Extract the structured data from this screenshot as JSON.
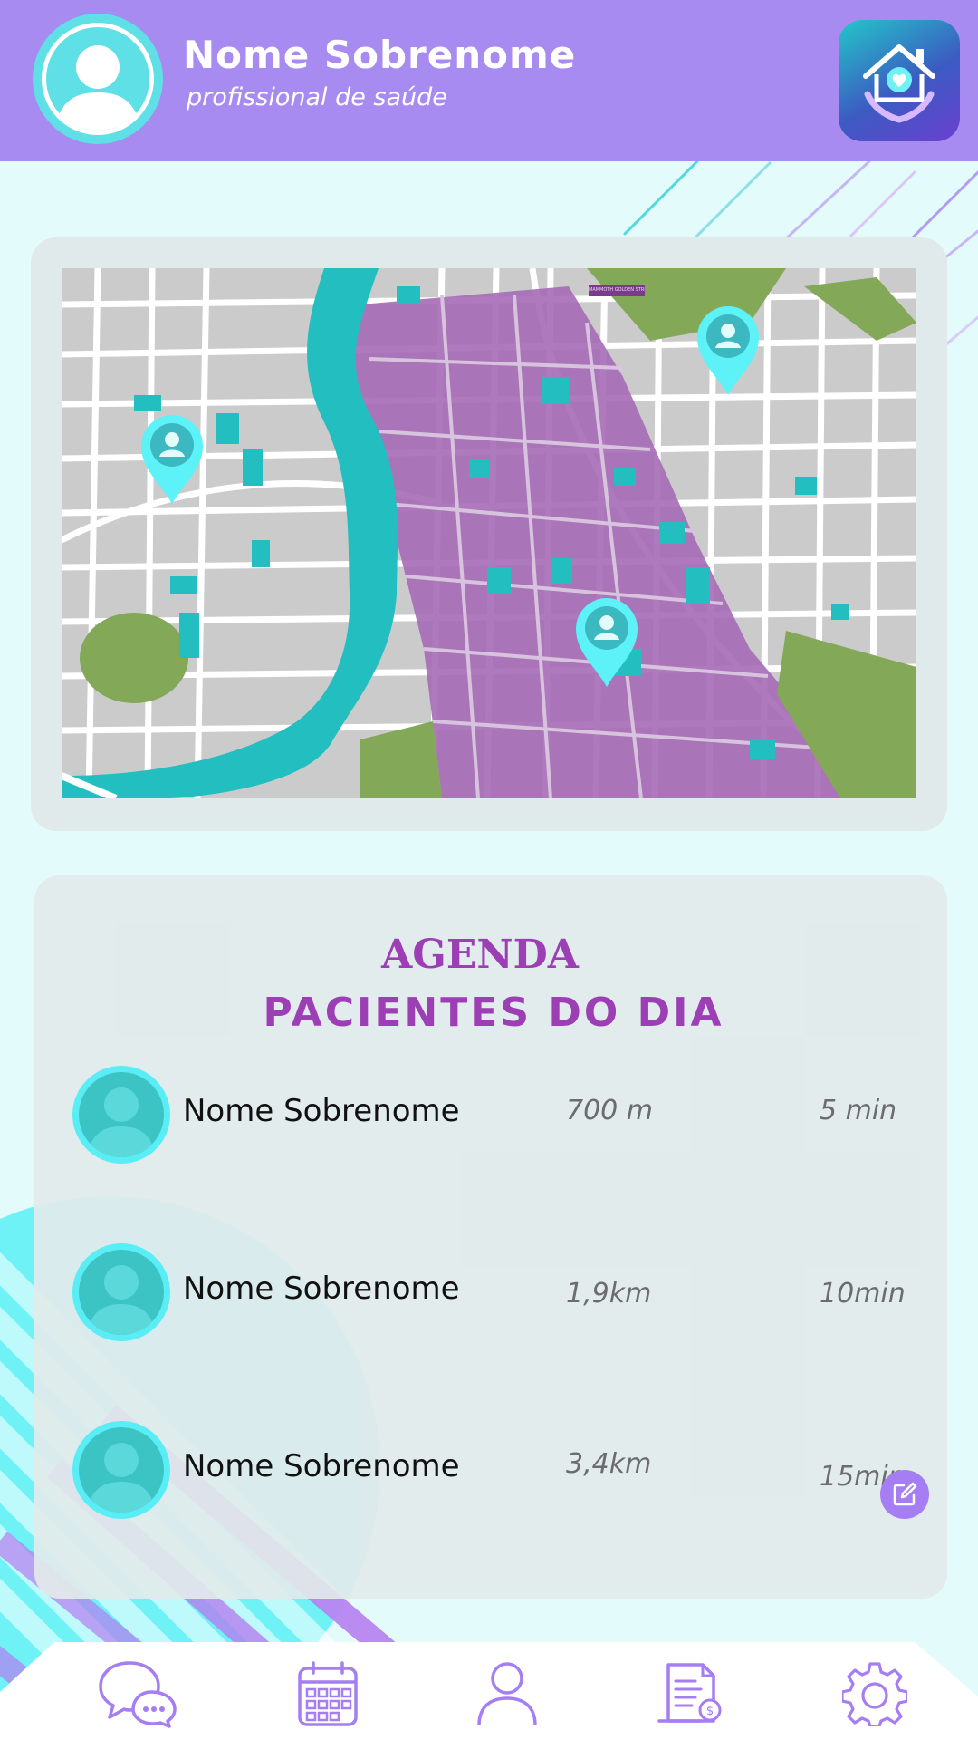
{
  "header": {
    "name": "Nome  Sobrenome",
    "role": "profissional de saúde"
  },
  "map": {
    "label": "MAMMOTH GOLDEN STREET"
  },
  "agenda": {
    "title": "AGENDA",
    "subtitle": "PACIENTES DO DIA",
    "patients": [
      {
        "name": "Nome Sobrenome",
        "distance": "700 m",
        "time": "5 min"
      },
      {
        "name": "Nome Sobrenome",
        "distance": "1,9km",
        "time": "10min"
      },
      {
        "name": "Nome Sobrenome",
        "distance": "3,4km",
        "time": "15min"
      }
    ]
  },
  "nav": {
    "items": [
      "chat-icon",
      "calendar-icon",
      "user-icon",
      "invoice-icon",
      "gear-icon"
    ]
  },
  "colors": {
    "header": "#a78bf0",
    "accent_cyan": "#59eef5",
    "title_purple": "#9c3fb5",
    "background": "#e4fbfb"
  }
}
